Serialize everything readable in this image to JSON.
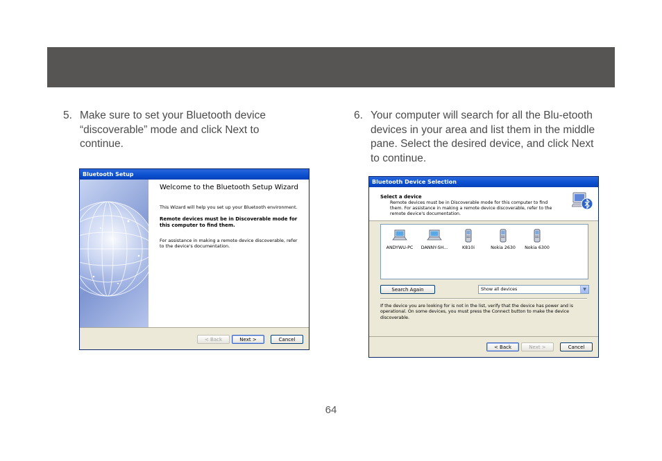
{
  "page_number": "64",
  "step5": {
    "number": "5.",
    "text": "Make sure to set your Bluetooth device “discoverable” mode and click Next to continue."
  },
  "step6": {
    "number": "6.",
    "text": "Your computer will search for all the Blu-etooth devices in your area and list them in the middle pane.  Select the desired device, and click Next to continue."
  },
  "wizard": {
    "title": "Bluetooth Setup",
    "heading": "Welcome to the Bluetooth Setup Wizard",
    "intro": "This Wizard will help you set up your Bluetooth environment.",
    "bold_note": "Remote devices must be in Discoverable mode for this computer to find them.",
    "assist": "For assistance in making a remote device discoverable, refer to the device's documentation.",
    "back_label": "< Back",
    "next_label": "Next >",
    "cancel_label": "Cancel"
  },
  "device_selection": {
    "title": "Bluetooth Device Selection",
    "section_title": "Select a device",
    "section_desc": "Remote devices must be in Discoverable mode for this computer to find them. For assistance in making a remote device discoverable, refer to the remote device's documentation.",
    "devices": [
      {
        "name": "ANDYWU-PC",
        "icon": "laptop-icon"
      },
      {
        "name": "DANNY-SH...",
        "icon": "laptop-icon"
      },
      {
        "name": "K810i",
        "icon": "mobile-phone-icon"
      },
      {
        "name": "Nokia 2630",
        "icon": "mobile-phone-icon"
      },
      {
        "name": "Nokia 6300",
        "icon": "mobile-phone-icon"
      }
    ],
    "search_again_label": "Search Again",
    "filter_value": "Show all devices",
    "hint": "If the device you are looking for is not in the list, verify that the device has power and is operational. On some devices, you must press the Connect button to make the device discoverable.",
    "back_label": "< Back",
    "next_label": "Next >",
    "cancel_label": "Cancel"
  }
}
